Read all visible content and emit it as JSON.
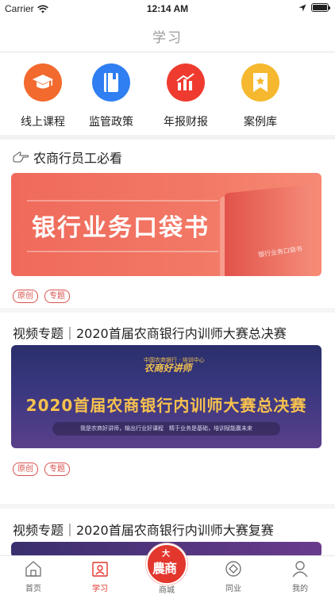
{
  "status_bar": {
    "carrier": "Carrier",
    "time": "12:14 AM",
    "battery_level": 1.0
  },
  "nav": {
    "title": "学习"
  },
  "categories": [
    {
      "label": "线上课程",
      "icon": "graduation-cap-icon",
      "color": "#f26a2e"
    },
    {
      "label": "监管政策",
      "icon": "book-icon",
      "color": "#2f7ff2"
    },
    {
      "label": "年报财报",
      "icon": "bar-chart-icon",
      "color": "#ef3b2f"
    },
    {
      "label": "案例库",
      "icon": "star-bookmark-icon",
      "color": "#f5b82e"
    }
  ],
  "section": {
    "icon": "pointing-hand-icon",
    "title": "农商行员工必看"
  },
  "articles": [
    {
      "banner_text": "银行业务口袋书",
      "banner_book_text": "银行业务口袋书",
      "tags": [
        "原创",
        "专题"
      ]
    },
    {
      "title": "视频专题｜2020首届农商银行内训师大赛总决赛",
      "banner_logo_top": "中国农商银行 · 培训中心",
      "banner_logo": "农商好讲师",
      "banner_title": "2020首届农商银行内训师大赛总决赛",
      "banner_sub": "我是农商好讲师，输出行业好课程　精于业务是基础，培训赋能赢未来",
      "tags": [
        "原创",
        "专题"
      ]
    },
    {
      "title": "视频专题｜2020首届农商银行内训师大赛复赛"
    }
  ],
  "tab_bar": {
    "items": [
      {
        "label": "首页",
        "icon": "home-icon"
      },
      {
        "label": "学习",
        "icon": "study-icon",
        "active": true
      },
      {
        "label": "商城",
        "icon": "mall-icon"
      },
      {
        "label": "同业",
        "icon": "peer-icon"
      },
      {
        "label": "我的",
        "icon": "profile-icon"
      }
    ],
    "center_badge_top": "大",
    "center_badge_main": "農商"
  },
  "colors": {
    "accent": "#e3372e",
    "tag": "#d9534f"
  }
}
